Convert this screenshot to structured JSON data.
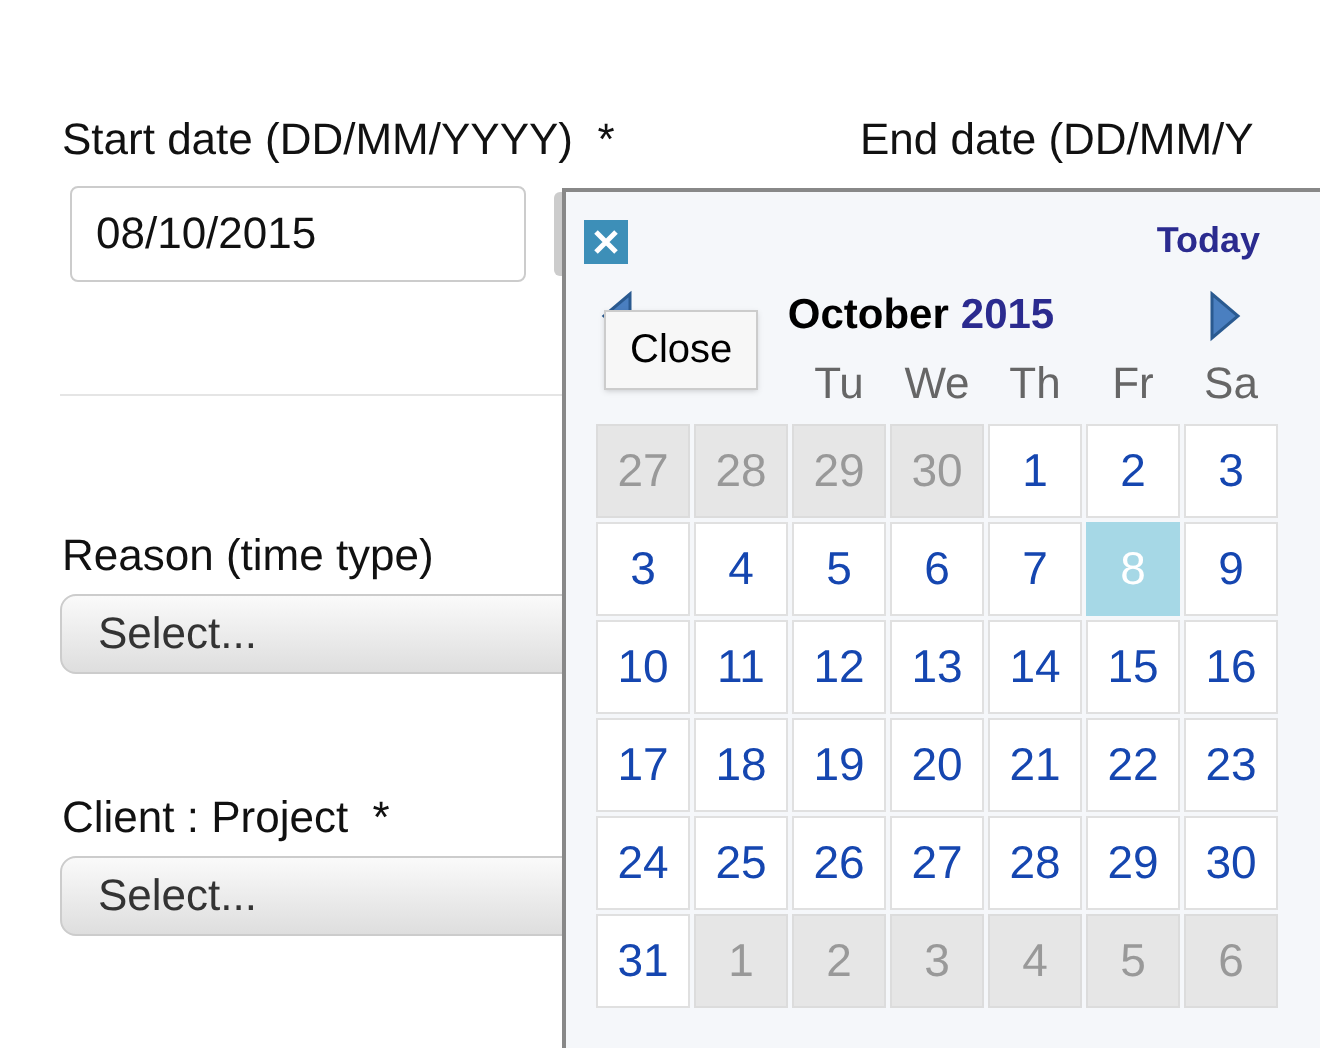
{
  "form": {
    "start_date": {
      "label": "Start date (DD/MM/YYYY)  *",
      "value": "08/10/2015"
    },
    "end_date": {
      "label": "End date (DD/MM/Y"
    },
    "reason": {
      "label": "Reason (time type)",
      "value": "Select..."
    },
    "client_project": {
      "label": "Client : Project  *",
      "value": "Select..."
    }
  },
  "calendar": {
    "today_link": "Today",
    "month": "October",
    "year": "2015",
    "tooltip": "Close",
    "weekdays": [
      "Tu",
      "We",
      "Th",
      "Fr",
      "Sa"
    ],
    "weeks": [
      [
        {
          "day": "27",
          "other_month": true,
          "selected": false
        },
        {
          "day": "28",
          "other_month": true,
          "selected": false
        },
        {
          "day": "29",
          "other_month": true,
          "selected": false
        },
        {
          "day": "30",
          "other_month": true,
          "selected": false
        },
        {
          "day": "1",
          "other_month": false,
          "selected": false
        },
        {
          "day": "2",
          "other_month": false,
          "selected": false
        },
        {
          "day": "3",
          "other_month": false,
          "selected": false
        }
      ],
      [
        {
          "day": "3",
          "other_month": false,
          "selected": false
        },
        {
          "day": "4",
          "other_month": false,
          "selected": false
        },
        {
          "day": "5",
          "other_month": false,
          "selected": false
        },
        {
          "day": "6",
          "other_month": false,
          "selected": false
        },
        {
          "day": "7",
          "other_month": false,
          "selected": false
        },
        {
          "day": "8",
          "other_month": false,
          "selected": true
        },
        {
          "day": "9",
          "other_month": false,
          "selected": false
        }
      ],
      [
        {
          "day": "10",
          "other_month": false,
          "selected": false
        },
        {
          "day": "11",
          "other_month": false,
          "selected": false
        },
        {
          "day": "12",
          "other_month": false,
          "selected": false
        },
        {
          "day": "13",
          "other_month": false,
          "selected": false
        },
        {
          "day": "14",
          "other_month": false,
          "selected": false
        },
        {
          "day": "15",
          "other_month": false,
          "selected": false
        },
        {
          "day": "16",
          "other_month": false,
          "selected": false
        }
      ],
      [
        {
          "day": "17",
          "other_month": false,
          "selected": false
        },
        {
          "day": "18",
          "other_month": false,
          "selected": false
        },
        {
          "day": "19",
          "other_month": false,
          "selected": false
        },
        {
          "day": "20",
          "other_month": false,
          "selected": false
        },
        {
          "day": "21",
          "other_month": false,
          "selected": false
        },
        {
          "day": "22",
          "other_month": false,
          "selected": false
        },
        {
          "day": "23",
          "other_month": false,
          "selected": false
        }
      ],
      [
        {
          "day": "24",
          "other_month": false,
          "selected": false
        },
        {
          "day": "25",
          "other_month": false,
          "selected": false
        },
        {
          "day": "26",
          "other_month": false,
          "selected": false
        },
        {
          "day": "27",
          "other_month": false,
          "selected": false
        },
        {
          "day": "28",
          "other_month": false,
          "selected": false
        },
        {
          "day": "29",
          "other_month": false,
          "selected": false
        },
        {
          "day": "30",
          "other_month": false,
          "selected": false
        }
      ],
      [
        {
          "day": "31",
          "other_month": false,
          "selected": false
        },
        {
          "day": "1",
          "other_month": true,
          "selected": false
        },
        {
          "day": "2",
          "other_month": true,
          "selected": false
        },
        {
          "day": "3",
          "other_month": true,
          "selected": false
        },
        {
          "day": "4",
          "other_month": true,
          "selected": false
        },
        {
          "day": "5",
          "other_month": true,
          "selected": false
        },
        {
          "day": "6",
          "other_month": true,
          "selected": false
        }
      ]
    ]
  }
}
